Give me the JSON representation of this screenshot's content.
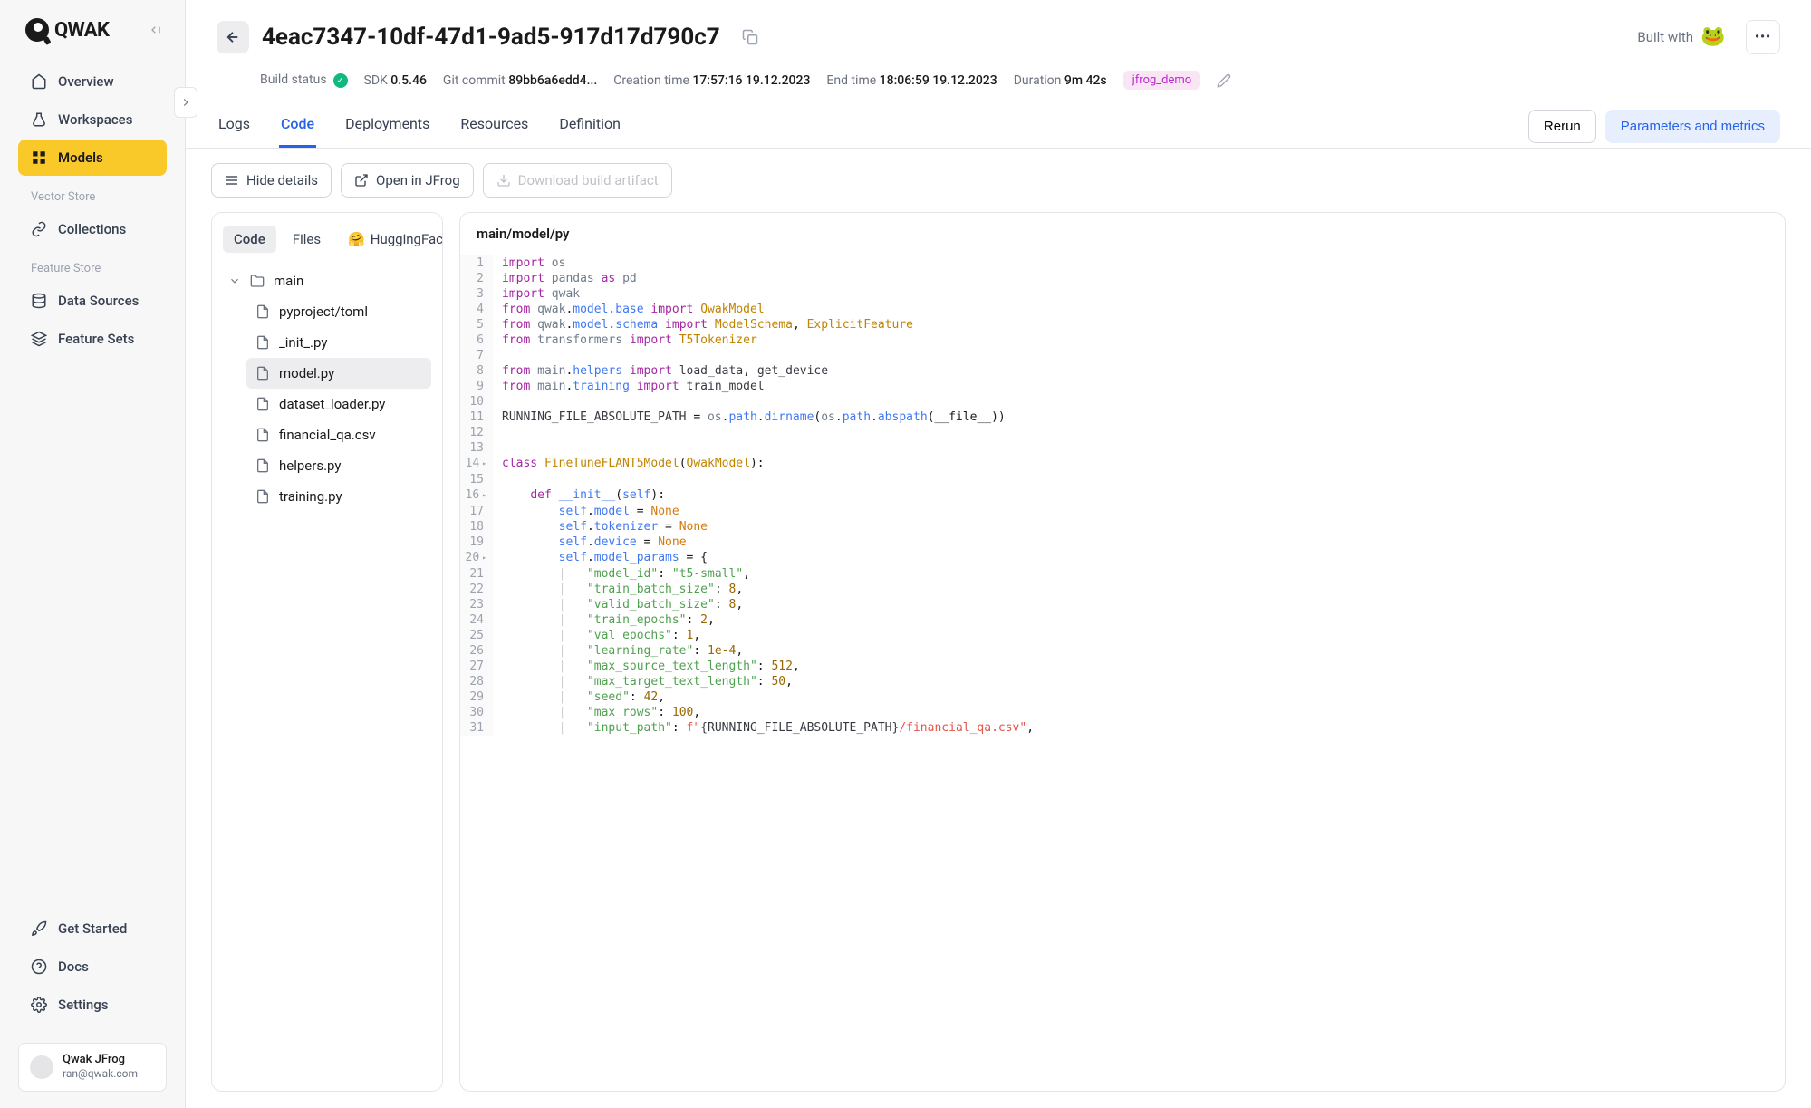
{
  "logo_text": "QWAK",
  "sidebar": {
    "items": [
      {
        "label": "Overview",
        "id": "overview"
      },
      {
        "label": "Workspaces",
        "id": "workspaces"
      },
      {
        "label": "Models",
        "id": "models"
      }
    ],
    "section_vector": "Vector Store",
    "vector_items": [
      {
        "label": "Collections",
        "id": "collections"
      }
    ],
    "section_feature": "Feature Store",
    "feature_items": [
      {
        "label": "Data Sources",
        "id": "data-sources"
      },
      {
        "label": "Feature Sets",
        "id": "feature-sets"
      }
    ],
    "bottom_items": [
      {
        "label": "Get Started",
        "id": "get-started"
      },
      {
        "label": "Docs",
        "id": "docs"
      },
      {
        "label": "Settings",
        "id": "settings"
      }
    ]
  },
  "user": {
    "name": "Qwak JFrog",
    "email": "ran@qwak.com"
  },
  "header": {
    "title": "4eac7347-10df-47d1-9ad5-917d17d790c7",
    "built_with": "Built with"
  },
  "meta": {
    "build_status_label": "Build status",
    "sdk_label": "SDK",
    "sdk_value": "0.5.46",
    "git_label": "Git commit",
    "git_value": "89bb6a6edd4...",
    "create_label": "Creation time",
    "create_value": "17:57:16 19.12.2023",
    "end_label": "End time",
    "end_value": "18:06:59 19.12.2023",
    "duration_label": "Duration",
    "duration_value": "9m 42s",
    "tag": "jfrog_demo"
  },
  "tabs": {
    "items": [
      "Logs",
      "Code",
      "Deployments",
      "Resources",
      "Definition"
    ],
    "active": "Code",
    "rerun": "Rerun",
    "params": "Parameters and metrics"
  },
  "toolbar": {
    "hide_details": "Hide details",
    "open_jfrog": "Open in JFrog",
    "download": "Download build artifact"
  },
  "tree": {
    "tabs": [
      "Code",
      "Files"
    ],
    "hf": "HuggingFace",
    "active": "Code",
    "root": "main",
    "files": [
      "pyproject/toml",
      "_init_.py",
      "model.py",
      "dataset_loader.py",
      "financial_qa.csv",
      "helpers.py",
      "training.py"
    ],
    "active_file": "model.py"
  },
  "code": {
    "path": "main/model/py",
    "lines": [
      {
        "n": 1,
        "h": "<span class='tk-kw'>import</span> <span class='tk-mod'>os</span>"
      },
      {
        "n": 2,
        "h": "<span class='tk-kw'>import</span> <span class='tk-mod'>pandas</span> <span class='tk-kw'>as</span> <span class='tk-mod'>pd</span>"
      },
      {
        "n": 3,
        "h": "<span class='tk-kw'>import</span> <span class='tk-mod'>qwak</span>"
      },
      {
        "n": 4,
        "h": "<span class='tk-kw'>from</span> <span class='tk-mod'>qwak</span>.<span class='tk-sub'>model</span>.<span class='tk-sub'>base</span> <span class='tk-kw'>import</span> <span class='tk-cls'>QwakModel</span>"
      },
      {
        "n": 5,
        "h": "<span class='tk-kw'>from</span> <span class='tk-mod'>qwak</span>.<span class='tk-sub'>model</span>.<span class='tk-sub'>schema</span> <span class='tk-kw'>import</span> <span class='tk-cls'>ModelSchema</span>, <span class='tk-cls'>ExplicitFeature</span>"
      },
      {
        "n": 6,
        "h": "<span class='tk-kw'>from</span> <span class='tk-mod'>transformers</span> <span class='tk-kw'>import</span> <span class='tk-cls'>T5Tokenizer</span>"
      },
      {
        "n": 7,
        "h": ""
      },
      {
        "n": 8,
        "h": "<span class='tk-kw'>from</span> <span class='tk-mod'>main</span>.<span class='tk-sub'>helpers</span> <span class='tk-kw'>import</span> <span class='tk-var'>load_data</span>, <span class='tk-var'>get_device</span>"
      },
      {
        "n": 9,
        "h": "<span class='tk-kw'>from</span> <span class='tk-mod'>main</span>.<span class='tk-sub'>training</span> <span class='tk-kw'>import</span> <span class='tk-var'>train_model</span>"
      },
      {
        "n": 10,
        "h": ""
      },
      {
        "n": 11,
        "h": "<span class='tk-var'>RUNNING_FILE_ABSOLUTE_PATH</span> = <span class='tk-mod'>os</span>.<span class='tk-sub'>path</span>.<span class='tk-sub'>dirname</span>(<span class='tk-mod'>os</span>.<span class='tk-sub'>path</span>.<span class='tk-sub'>abspath</span>(__file__))"
      },
      {
        "n": 12,
        "h": ""
      },
      {
        "n": 13,
        "h": ""
      },
      {
        "n": 14,
        "fold": true,
        "h": "<span class='tk-kw'>class</span> <span class='tk-cls'>FineTuneFLANT5Model</span>(<span class='tk-cls'>QwakModel</span>):"
      },
      {
        "n": 15,
        "h": ""
      },
      {
        "n": 16,
        "fold": true,
        "h": "    <span class='tk-kw'>def</span> <span class='tk-fn'>__init__</span>(<span class='tk-self'>self</span>):"
      },
      {
        "n": 17,
        "h": "        <span class='tk-self'>self</span>.<span class='tk-attr'>model</span> = <span class='tk-const'>None</span>"
      },
      {
        "n": 18,
        "h": "        <span class='tk-self'>self</span>.<span class='tk-attr'>tokenizer</span> = <span class='tk-const'>None</span>"
      },
      {
        "n": 19,
        "h": "        <span class='tk-self'>self</span>.<span class='tk-attr'>device</span> = <span class='tk-const'>None</span>"
      },
      {
        "n": 20,
        "fold": true,
        "h": "        <span class='tk-self'>self</span>.<span class='tk-attr'>model_params</span> = {"
      },
      {
        "n": 21,
        "h": "        <span class='pipe'>|</span>   <span class='tk-str'>\"model_id\"</span>: <span class='tk-str'>\"t5-small\"</span>,"
      },
      {
        "n": 22,
        "h": "        <span class='pipe'>|</span>   <span class='tk-str'>\"train_batch_size\"</span>: <span class='tk-num'>8</span>,"
      },
      {
        "n": 23,
        "h": "        <span class='pipe'>|</span>   <span class='tk-str'>\"valid_batch_size\"</span>: <span class='tk-num'>8</span>,"
      },
      {
        "n": 24,
        "h": "        <span class='pipe'>|</span>   <span class='tk-str'>\"train_epochs\"</span>: <span class='tk-num'>2</span>,"
      },
      {
        "n": 25,
        "h": "        <span class='pipe'>|</span>   <span class='tk-str'>\"val_epochs\"</span>: <span class='tk-num'>1</span>,"
      },
      {
        "n": 26,
        "h": "        <span class='pipe'>|</span>   <span class='tk-str'>\"learning_rate\"</span>: <span class='tk-num'>1e-4</span>,"
      },
      {
        "n": 27,
        "h": "        <span class='pipe'>|</span>   <span class='tk-str'>\"max_source_text_length\"</span>: <span class='tk-num'>512</span>,"
      },
      {
        "n": 28,
        "h": "        <span class='pipe'>|</span>   <span class='tk-str'>\"max_target_text_length\"</span>: <span class='tk-num'>50</span>,"
      },
      {
        "n": 29,
        "h": "        <span class='pipe'>|</span>   <span class='tk-str'>\"seed\"</span>: <span class='tk-num'>42</span>,"
      },
      {
        "n": 30,
        "h": "        <span class='pipe'>|</span>   <span class='tk-str'>\"max_rows\"</span>: <span class='tk-num'>100</span>,"
      },
      {
        "n": 31,
        "h": "        <span class='pipe'>|</span>   <span class='tk-str'>\"input_path\"</span>: <span class='tk-fstr'>f\"</span><span class='tk-var'>{RUNNING_FILE_ABSOLUTE_PATH}</span><span class='tk-id'>/financial_qa.csv</span><span class='tk-fstr'>\"</span>,"
      }
    ]
  }
}
